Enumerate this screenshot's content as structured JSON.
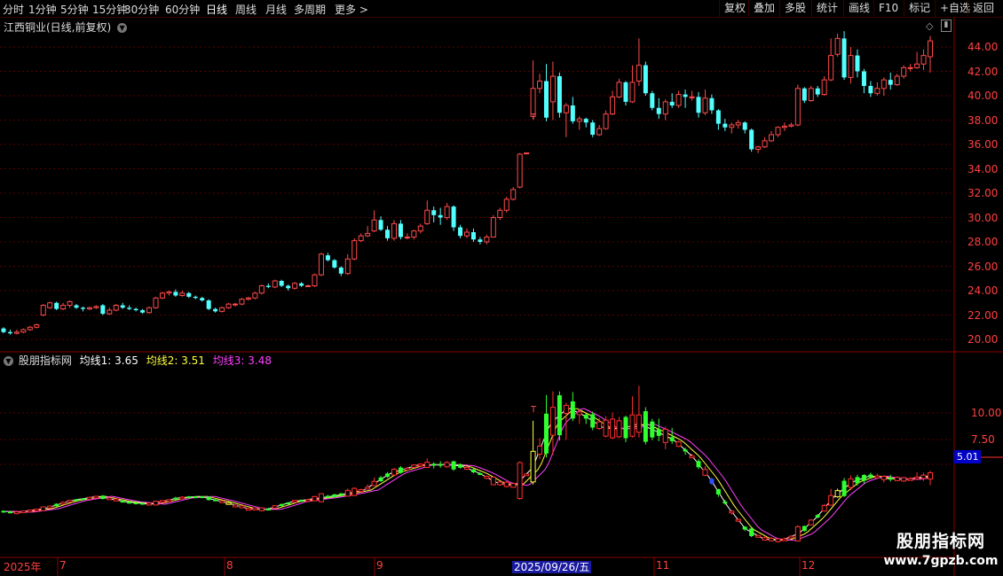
{
  "toolbar": {
    "periods": [
      "分时",
      "1分钟",
      "5分钟",
      "15分钟",
      "30分钟",
      "60分钟",
      "日线",
      "周线",
      "月线",
      "多周期",
      "更多 >"
    ],
    "active_period": "日线",
    "actions": [
      "复权",
      "叠加",
      "多股",
      "统计",
      "画线",
      "F10",
      "标记",
      "+自选",
      "返回"
    ]
  },
  "main_panel": {
    "title": "江西铜业(日线,前复权)",
    "y_axis_labels": [
      "44.00",
      "42.00",
      "40.00",
      "38.00",
      "36.00",
      "34.00",
      "32.00",
      "30.00",
      "28.00",
      "26.00",
      "24.00",
      "22.00",
      "20.00"
    ]
  },
  "indicator_panel": {
    "name": "股朋指标网",
    "ma1_label": "均线1: 3.65",
    "ma2_label": "均线2: 3.51",
    "ma3_label": "均线3: 3.48",
    "y_axis_labels": [
      "10.00",
      "7.50"
    ],
    "current_badge": "5.01"
  },
  "x_axis": {
    "labels": [
      "2025年",
      "7",
      "8",
      "9",
      "11",
      "12"
    ],
    "selected_date": "2025/09/26/五"
  },
  "watermark": {
    "line1": "股朋指标网",
    "line2": "www.7gpzb.com"
  },
  "chart_data": {
    "type": "candlestick",
    "title": "江西铜业(日线,前复权)",
    "price_ylim": [
      19.5,
      45.5
    ],
    "candles_ohlc": [
      [
        20.9,
        20.6,
        21.0,
        20.5
      ],
      [
        20.6,
        20.5,
        20.8,
        20.4
      ],
      [
        20.5,
        20.6,
        20.8,
        20.4
      ],
      [
        20.6,
        20.8,
        20.9,
        20.5
      ],
      [
        20.8,
        21.0,
        21.1,
        20.7
      ],
      [
        21.0,
        21.2,
        21.3,
        20.9
      ],
      [
        22.0,
        22.8,
        22.9,
        21.9
      ],
      [
        22.6,
        23.0,
        23.1,
        22.5
      ],
      [
        23.0,
        22.5,
        23.1,
        22.4
      ],
      [
        22.5,
        22.8,
        23.0,
        22.4
      ],
      [
        22.8,
        23.1,
        23.2,
        22.6
      ],
      [
        22.8,
        22.6,
        22.9,
        22.5
      ],
      [
        22.6,
        22.5,
        22.7,
        22.3
      ],
      [
        22.5,
        22.6,
        22.7,
        22.4
      ],
      [
        22.6,
        22.7,
        22.8,
        22.5
      ],
      [
        22.8,
        22.1,
        22.9,
        22.0
      ],
      [
        22.1,
        22.4,
        22.6,
        22.0
      ],
      [
        22.4,
        22.8,
        22.9,
        22.3
      ],
      [
        22.8,
        22.6,
        23.0,
        22.5
      ],
      [
        22.6,
        22.5,
        22.8,
        22.4
      ],
      [
        22.5,
        22.4,
        22.6,
        22.3
      ],
      [
        22.4,
        22.2,
        22.5,
        22.1
      ],
      [
        22.2,
        22.6,
        22.7,
        22.1
      ],
      [
        22.6,
        23.4,
        23.5,
        22.5
      ],
      [
        23.4,
        23.8,
        23.9,
        23.3
      ],
      [
        23.8,
        23.9,
        24.0,
        23.6
      ],
      [
        23.9,
        23.6,
        24.1,
        23.5
      ],
      [
        23.6,
        23.8,
        24.0,
        23.5
      ],
      [
        23.8,
        23.5,
        23.9,
        23.4
      ],
      [
        23.5,
        23.4,
        23.6,
        23.3
      ],
      [
        23.4,
        23.2,
        23.5,
        23.1
      ],
      [
        23.2,
        22.5,
        23.3,
        22.4
      ],
      [
        22.5,
        22.3,
        22.6,
        22.2
      ],
      [
        22.3,
        22.6,
        22.7,
        22.2
      ],
      [
        22.6,
        22.9,
        23.0,
        22.5
      ],
      [
        22.9,
        22.9,
        23.0,
        22.7
      ],
      [
        22.9,
        23.3,
        23.4,
        22.8
      ],
      [
        23.3,
        23.4,
        23.5,
        23.2
      ],
      [
        23.4,
        23.8,
        23.9,
        23.3
      ],
      [
        23.8,
        24.4,
        24.5,
        23.7
      ],
      [
        24.4,
        24.3,
        24.6,
        24.2
      ],
      [
        24.3,
        24.8,
        24.9,
        24.2
      ],
      [
        24.8,
        24.4,
        24.9,
        24.3
      ],
      [
        24.4,
        24.2,
        24.5,
        24.0
      ],
      [
        24.2,
        24.6,
        24.7,
        24.1
      ],
      [
        24.6,
        24.4,
        24.7,
        24.3
      ],
      [
        24.4,
        24.4,
        24.5,
        24.3
      ],
      [
        24.4,
        25.3,
        25.4,
        24.3
      ],
      [
        25.3,
        27.0,
        27.1,
        25.2
      ],
      [
        26.9,
        26.5,
        27.1,
        26.4
      ],
      [
        26.5,
        25.9,
        26.6,
        25.8
      ],
      [
        25.9,
        25.4,
        26.0,
        25.2
      ],
      [
        25.4,
        26.6,
        27.0,
        25.3
      ],
      [
        26.6,
        28.1,
        28.3,
        26.5
      ],
      [
        28.1,
        28.5,
        28.7,
        28.0
      ],
      [
        28.5,
        28.7,
        29.3,
        28.4
      ],
      [
        28.9,
        29.8,
        30.6,
        28.8
      ],
      [
        29.8,
        29.0,
        30.1,
        28.9
      ],
      [
        29.0,
        28.3,
        29.3,
        28.1
      ],
      [
        28.3,
        29.5,
        29.8,
        28.1
      ],
      [
        29.5,
        28.4,
        29.8,
        28.2
      ],
      [
        28.4,
        28.4,
        28.7,
        28.2
      ],
      [
        28.4,
        28.9,
        29.0,
        28.2
      ],
      [
        28.9,
        29.3,
        29.5,
        28.7
      ],
      [
        29.5,
        30.6,
        31.4,
        29.4
      ],
      [
        30.6,
        30.2,
        30.9,
        29.6
      ],
      [
        30.2,
        30.0,
        30.8,
        29.4
      ],
      [
        30.0,
        30.9,
        31.2,
        29.8
      ],
      [
        30.9,
        29.2,
        31.0,
        28.9
      ],
      [
        29.2,
        28.5,
        29.4,
        28.3
      ],
      [
        28.5,
        28.8,
        29.1,
        28.3
      ],
      [
        28.8,
        28.2,
        29.1,
        28.0
      ],
      [
        28.2,
        28.0,
        28.4,
        27.8
      ],
      [
        28.0,
        28.4,
        28.6,
        27.8
      ],
      [
        28.4,
        30.0,
        30.2,
        29.6
      ],
      [
        30.0,
        30.6,
        30.8,
        29.8
      ],
      [
        30.6,
        31.5,
        31.7,
        30.4
      ],
      [
        31.5,
        32.3,
        32.5,
        31.4
      ],
      [
        32.5,
        35.2,
        35.3,
        32.4
      ],
      [
        35.3,
        35.3,
        35.3,
        35.3
      ],
      [
        38.3,
        40.6,
        42.9,
        38.1
      ],
      [
        40.6,
        41.2,
        41.8,
        40.2
      ],
      [
        41.2,
        38.2,
        42.6,
        37.9
      ],
      [
        39.5,
        41.6,
        42.8,
        38.0
      ],
      [
        41.6,
        38.6,
        41.9,
        38.2
      ],
      [
        38.6,
        39.2,
        39.4,
        36.6
      ],
      [
        39.2,
        37.9,
        39.9,
        37.7
      ],
      [
        37.9,
        38.1,
        38.3,
        37.2
      ],
      [
        38.1,
        37.8,
        38.2,
        37.4
      ],
      [
        37.8,
        36.8,
        38.0,
        36.6
      ],
      [
        36.8,
        37.3,
        37.6,
        36.7
      ],
      [
        37.3,
        38.5,
        38.8,
        37.2
      ],
      [
        38.5,
        39.9,
        40.4,
        38.4
      ],
      [
        39.9,
        41.1,
        41.4,
        39.8
      ],
      [
        41.1,
        39.5,
        41.2,
        39.2
      ],
      [
        39.5,
        41.1,
        42.5,
        39.4
      ],
      [
        41.2,
        42.5,
        44.7,
        40.8
      ],
      [
        42.5,
        40.2,
        42.8,
        40.0
      ],
      [
        40.2,
        39.0,
        40.4,
        38.8
      ],
      [
        39.0,
        38.5,
        39.8,
        38.1
      ],
      [
        38.5,
        39.5,
        39.7,
        38.0
      ],
      [
        39.5,
        39.2,
        40.2,
        39.0
      ],
      [
        39.2,
        40.1,
        40.4,
        39.0
      ],
      [
        40.1,
        39.9,
        40.5,
        39.0
      ],
      [
        39.9,
        39.9,
        40.4,
        39.6
      ],
      [
        39.9,
        38.6,
        40.3,
        38.2
      ],
      [
        38.6,
        39.8,
        40.5,
        38.4
      ],
      [
        39.8,
        38.8,
        40.1,
        38.5
      ],
      [
        38.8,
        37.7,
        38.9,
        37.2
      ],
      [
        37.7,
        37.4,
        38.1,
        37.1
      ],
      [
        37.4,
        37.6,
        37.8,
        36.9
      ],
      [
        37.6,
        37.8,
        38.0,
        37.3
      ],
      [
        37.8,
        37.2,
        37.9,
        36.9
      ],
      [
        37.2,
        35.6,
        37.3,
        35.4
      ],
      [
        35.6,
        35.8,
        35.9,
        35.3
      ],
      [
        35.8,
        36.3,
        36.6,
        35.7
      ],
      [
        36.3,
        36.8,
        37.1,
        36.2
      ],
      [
        36.8,
        37.4,
        37.5,
        36.6
      ],
      [
        37.4,
        37.5,
        37.8,
        37.1
      ],
      [
        37.5,
        37.6,
        37.8,
        37.4
      ],
      [
        37.6,
        40.6,
        40.9,
        37.5
      ],
      [
        40.6,
        39.6,
        40.7,
        39.4
      ],
      [
        39.6,
        40.6,
        40.8,
        39.5
      ],
      [
        40.6,
        40.1,
        40.8,
        39.9
      ],
      [
        40.1,
        41.3,
        41.6,
        40.0
      ],
      [
        41.3,
        43.3,
        44.7,
        41.2
      ],
      [
        43.4,
        44.7,
        45.1,
        43.2
      ],
      [
        44.7,
        41.5,
        45.3,
        41.3
      ],
      [
        41.5,
        43.3,
        44.0,
        41.0
      ],
      [
        43.3,
        42.0,
        43.8,
        41.5
      ],
      [
        42.0,
        40.8,
        42.2,
        40.2
      ],
      [
        40.8,
        40.2,
        41.2,
        39.9
      ],
      [
        40.2,
        40.6,
        41.1,
        40.0
      ],
      [
        40.6,
        41.3,
        41.5,
        40.0
      ],
      [
        41.3,
        40.9,
        41.9,
        40.5
      ],
      [
        40.9,
        41.6,
        41.8,
        40.8
      ],
      [
        41.6,
        42.3,
        42.5,
        41.4
      ],
      [
        42.3,
        42.3,
        42.6,
        42.0
      ],
      [
        42.3,
        42.6,
        43.6,
        42.2
      ],
      [
        42.6,
        43.3,
        43.8,
        42.1
      ],
      [
        43.2,
        44.5,
        44.9,
        41.9
      ]
    ],
    "indicator": {
      "name": "股朋指标网",
      "series": [
        {
          "name": "均线1",
          "last_value": 3.65
        },
        {
          "name": "均线2",
          "last_value": 3.51
        },
        {
          "name": "均线3",
          "last_value": 3.48
        }
      ],
      "y_axis_labels": [
        10.0,
        7.5
      ]
    },
    "x_axis_labels": [
      "2025年",
      "7",
      "8",
      "9",
      "2025/09/26/五",
      "11",
      "12"
    ]
  }
}
